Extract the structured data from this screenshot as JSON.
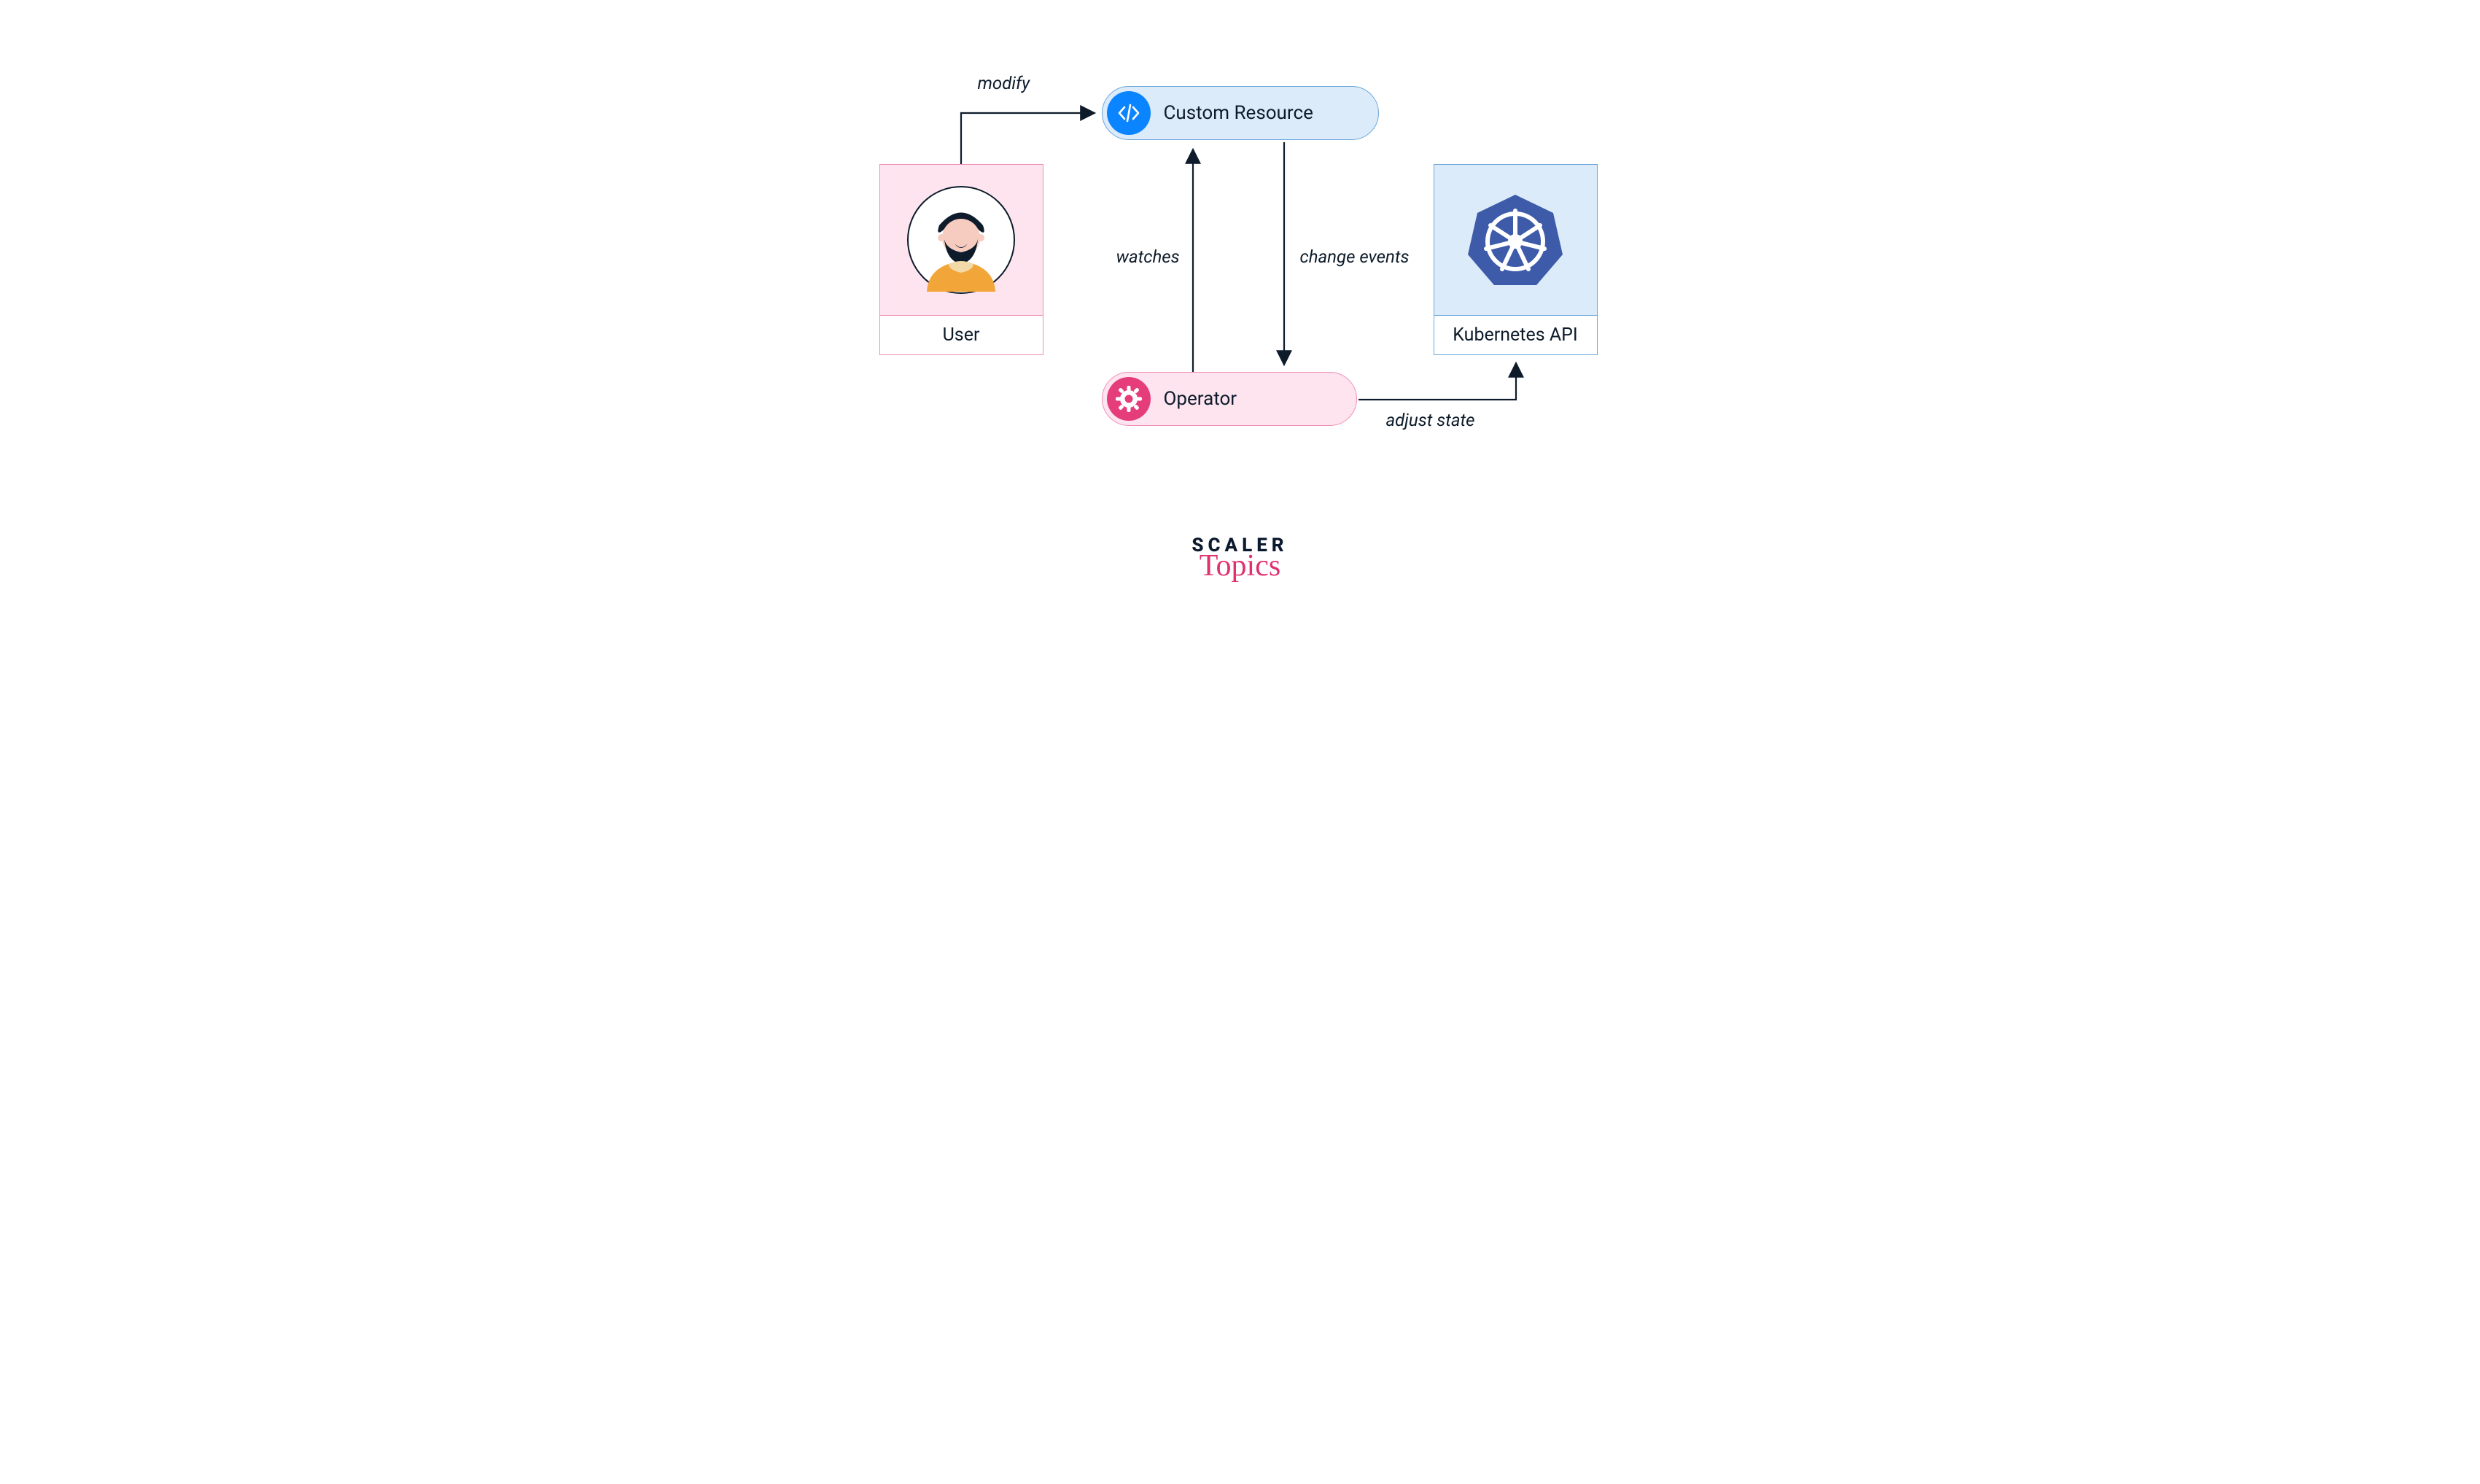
{
  "nodes": {
    "user": {
      "label": "User",
      "icon": "person-icon"
    },
    "custom_resource": {
      "label": "Custom Resource",
      "icon": "code-icon"
    },
    "operator": {
      "label": "Operator",
      "icon": "gear-icon"
    },
    "k8s_api": {
      "label": "Kubernetes API",
      "icon": "kubernetes-icon"
    }
  },
  "edges": {
    "modify": {
      "label": "modify",
      "from": "user",
      "to": "custom_resource"
    },
    "watches": {
      "label": "watches",
      "from": "operator",
      "to": "custom_resource"
    },
    "change_events": {
      "label": "change events",
      "from": "custom_resource",
      "to": "operator"
    },
    "adjust_state": {
      "label": "adjust state",
      "from": "operator",
      "to": "k8s_api"
    }
  },
  "branding": {
    "top": "SCALER",
    "bottom": "Topics"
  },
  "colors": {
    "blue_fill": "#dcebfa",
    "blue_border": "#6ca7d9",
    "blue_icon": "#0a84ff",
    "pink_fill": "#fde4ef",
    "pink_border": "#f08fb6",
    "pink_icon": "#e43d7a",
    "k8s": "#3e5ba9",
    "stroke": "#0d1b2a"
  }
}
